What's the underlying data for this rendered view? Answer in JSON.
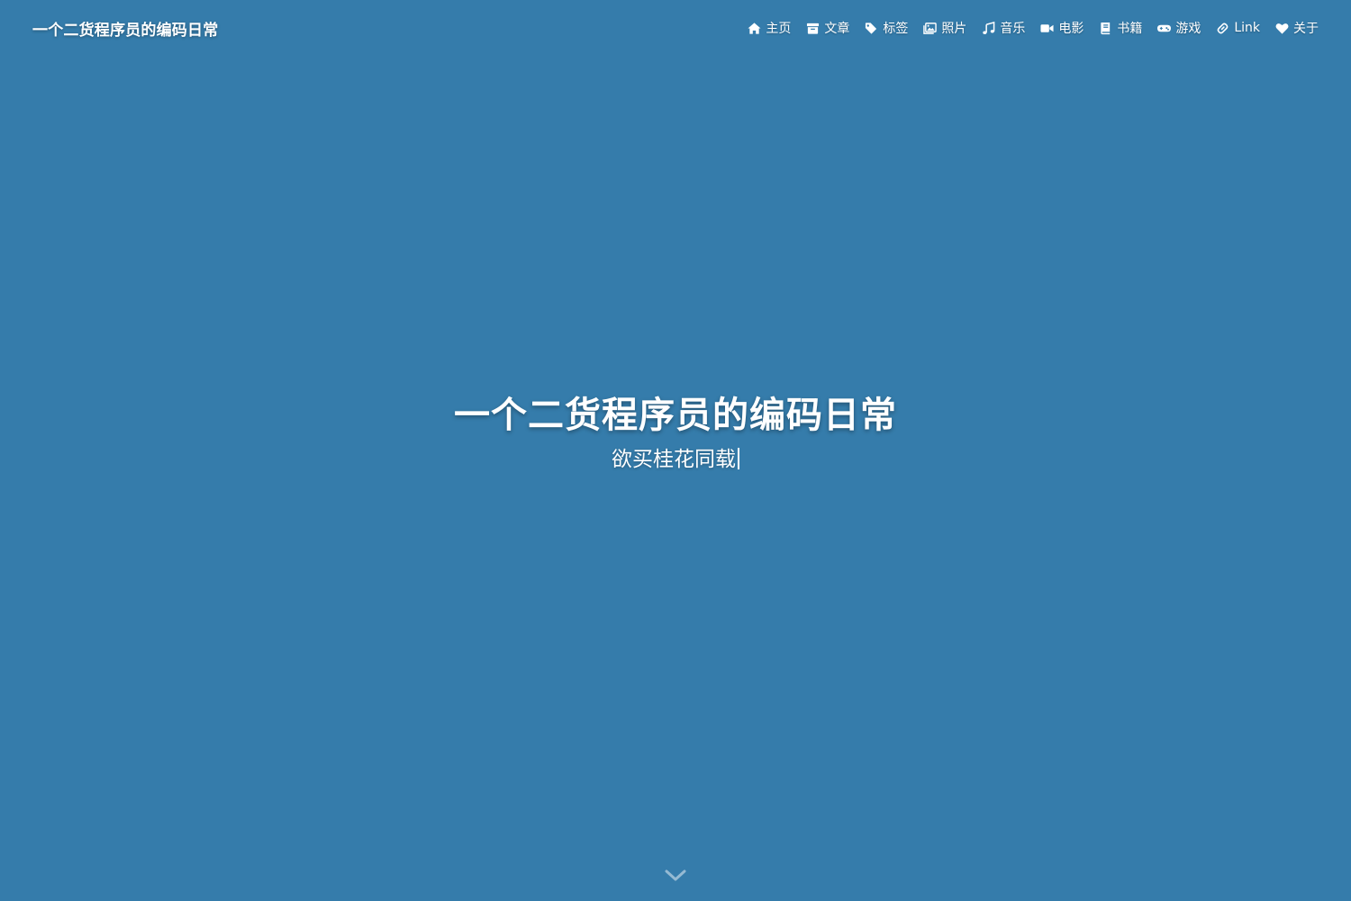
{
  "site": {
    "title": "一个二货程序员的编码日常",
    "background_color": "#357cab"
  },
  "nav": {
    "items": [
      {
        "label": "主页",
        "icon": "home-icon"
      },
      {
        "label": "文章",
        "icon": "archive-icon"
      },
      {
        "label": "标签",
        "icon": "tags-icon"
      },
      {
        "label": "照片",
        "icon": "images-icon"
      },
      {
        "label": "音乐",
        "icon": "music-icon"
      },
      {
        "label": "电影",
        "icon": "video-icon"
      },
      {
        "label": "书籍",
        "icon": "book-icon"
      },
      {
        "label": "游戏",
        "icon": "gamepad-icon"
      },
      {
        "label": "Link",
        "icon": "link-icon"
      },
      {
        "label": "关于",
        "icon": "heart-icon"
      }
    ]
  },
  "hero": {
    "title": "一个二货程序员的编码日常",
    "subtitle": "欲买桂花同载"
  },
  "scroll": {
    "icon": "chevron-down-icon"
  }
}
